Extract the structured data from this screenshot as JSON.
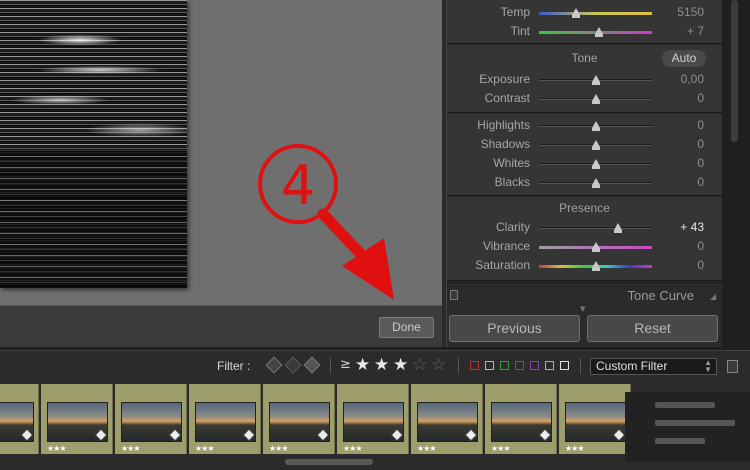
{
  "viewer": {
    "annotation_number": "4",
    "done_label": "Done"
  },
  "basic_panel": {
    "wb_rows": [
      {
        "label": "Temp",
        "value": "5150",
        "pos": 0.33
      },
      {
        "label": "Tint",
        "value": "+ 7",
        "pos": 0.53
      }
    ],
    "tone_header": "Tone",
    "auto_label": "Auto",
    "tone_rows": [
      {
        "label": "Exposure",
        "value": "0,00",
        "pos": 0.5
      },
      {
        "label": "Contrast",
        "value": "0",
        "pos": 0.5
      }
    ],
    "light_rows": [
      {
        "label": "Highlights",
        "value": "0",
        "pos": 0.5
      },
      {
        "label": "Shadows",
        "value": "0",
        "pos": 0.5
      },
      {
        "label": "Whites",
        "value": "0",
        "pos": 0.5
      },
      {
        "label": "Blacks",
        "value": "0",
        "pos": 0.5
      }
    ],
    "presence_header": "Presence",
    "presence_rows": [
      {
        "label": "Clarity",
        "value": "+ 43",
        "pos": 0.7
      },
      {
        "label": "Vibrance",
        "value": "0",
        "pos": 0.5
      },
      {
        "label": "Saturation",
        "value": "0",
        "pos": 0.5
      }
    ],
    "tone_curve_label": "Tone Curve",
    "previous_label": "Previous",
    "reset_label": "Reset"
  },
  "filter_bar": {
    "label": "Filter :",
    "gte_symbol": "≥",
    "stars_filled": 3,
    "stars_total": 5,
    "star_filled_glyph": "★",
    "star_empty_glyph": "☆",
    "color_labels": [
      "#c03030",
      "#c8c030",
      "#30a030",
      "#3060c0",
      "#9040b0",
      "#b0b0b0",
      "#e0e0e0"
    ],
    "custom_filter": "Custom Filter"
  },
  "filmstrip": {
    "cells": [
      {
        "stars": "★★★"
      },
      {
        "stars": "★★★"
      },
      {
        "stars": "★★★"
      },
      {
        "stars": "★★★"
      },
      {
        "stars": "★★★"
      },
      {
        "stars": "★★★"
      },
      {
        "stars": "★★★"
      },
      {
        "stars": "★★★"
      },
      {
        "stars": "★★★"
      }
    ]
  }
}
